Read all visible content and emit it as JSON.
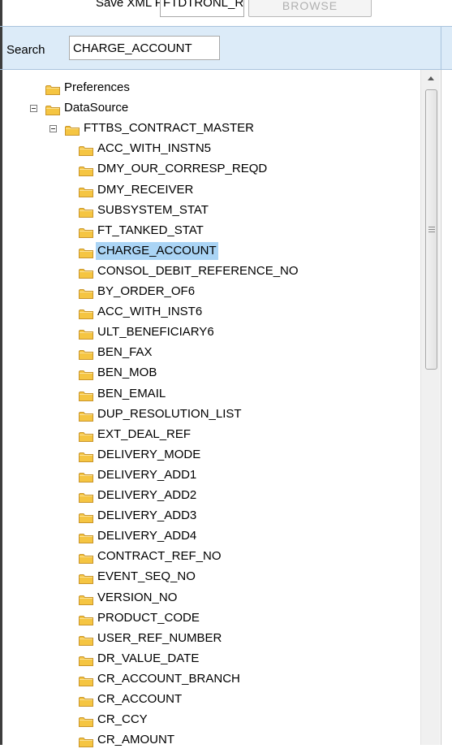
{
  "top": {
    "save_label": "Save XML Path",
    "save_value": "FTDTRONL_R",
    "browse_label": "BROWSE"
  },
  "search": {
    "label": "Search",
    "value": "CHARGE_ACCOUNT"
  },
  "tree": {
    "root_preferences": "Preferences",
    "root_datasource": "DataSource",
    "table": "FTTBS_CONTRACT_MASTER",
    "selected_item": "CHARGE_ACCOUNT",
    "fields": [
      "ACC_WITH_INSTN5",
      "DMY_OUR_CORRESP_REQD",
      "DMY_RECEIVER",
      "SUBSYSTEM_STAT",
      "FT_TANKED_STAT",
      "CHARGE_ACCOUNT",
      "CONSOL_DEBIT_REFERENCE_NO",
      "BY_ORDER_OF6",
      "ACC_WITH_INST6",
      "ULT_BENEFICIARY6",
      "BEN_FAX",
      "BEN_MOB",
      "BEN_EMAIL",
      "DUP_RESOLUTION_LIST",
      "EXT_DEAL_REF",
      "DELIVERY_MODE",
      "DELIVERY_ADD1",
      "DELIVERY_ADD2",
      "DELIVERY_ADD3",
      "DELIVERY_ADD4",
      "CONTRACT_REF_NO",
      "EVENT_SEQ_NO",
      "VERSION_NO",
      "PRODUCT_CODE",
      "USER_REF_NUMBER",
      "DR_VALUE_DATE",
      "CR_ACCOUNT_BRANCH",
      "CR_ACCOUNT",
      "CR_CCY",
      "CR_AMOUNT"
    ]
  },
  "colors": {
    "folder": "#f5c542",
    "selection": "#aad4f5",
    "search_bar": "#dcebf8"
  },
  "icons": {
    "folder": "folder-icon",
    "collapse": "collapse-toggle-icon",
    "scroll_up": "scroll-up-arrow-icon"
  }
}
